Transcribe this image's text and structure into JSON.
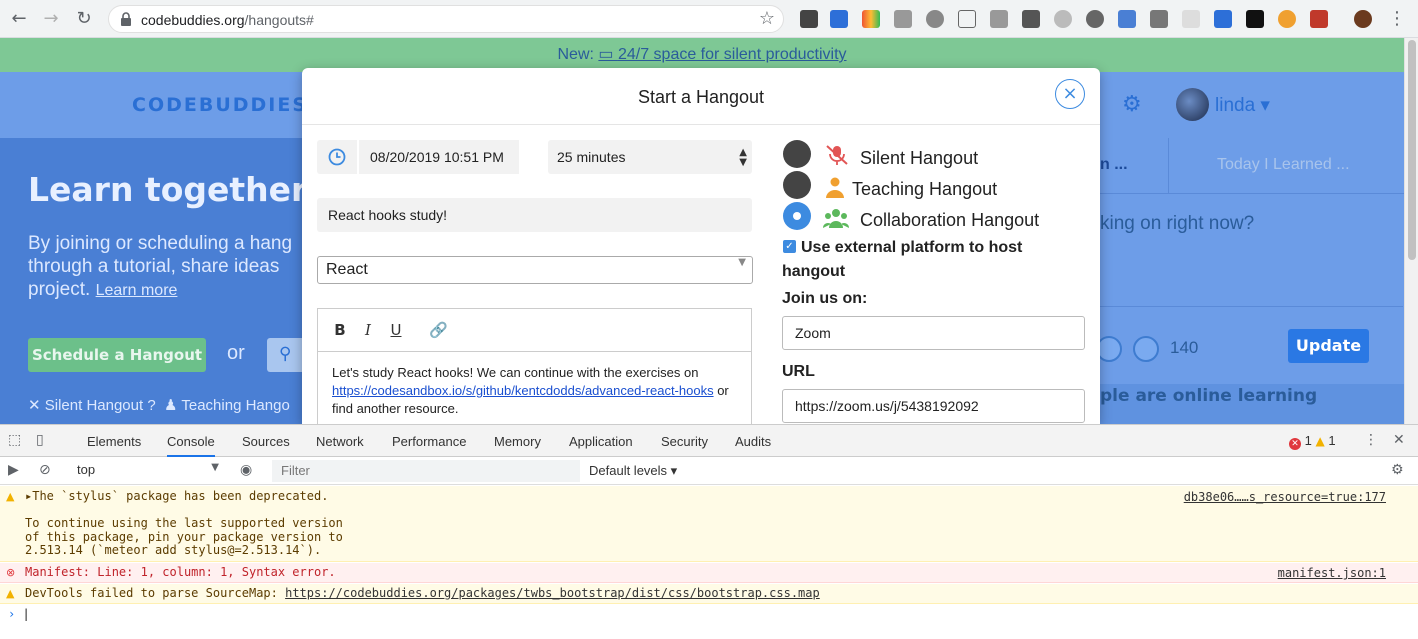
{
  "browser": {
    "url_domain": "codebuddies.org",
    "url_path": "/hangouts#"
  },
  "page": {
    "banner_prefix": "New: ",
    "banner_link": "24/7 space for silent productivity",
    "logo": "CODEBUDDIES",
    "username": "linda",
    "hero_title": "Learn together in",
    "hero_text_1": "By joining or scheduling a hang",
    "hero_text_2": "through a tutorial, share ideas",
    "hero_text_3": "project.",
    "learn_more": "Learn more",
    "schedule_button": "Schedule a Hangout",
    "or_text": "or",
    "legend_silent": "Silent Hangout",
    "legend_teaching": "Teaching Hango",
    "tab_working_on": "n ...",
    "tab_til": "Today I Learned ...",
    "textarea_placeholder": "king on right now?",
    "online_count": "140",
    "update_button": "Update",
    "online_text": "ple are online learning"
  },
  "modal": {
    "title": "Start a Hangout",
    "close_label": "×",
    "date_value": "08/20/2019 10:51 PM",
    "duration_value": "25 minutes",
    "topic_value": "React hooks study!",
    "tag_value": "React",
    "editor_text_1": "Let's study React hooks! We can continue with the exercises on",
    "editor_link": "https://codesandbox.io/s/github/kentcdodds/advanced-react-hooks",
    "editor_text_2": " or",
    "editor_text_3": "find another resource.",
    "hangout_types": [
      {
        "label": "Silent Hangout",
        "selected": false
      },
      {
        "label": "Teaching Hangout",
        "selected": false
      },
      {
        "label": "Collaboration Hangout",
        "selected": true
      }
    ],
    "external_label": "Use external platform to host hangout",
    "external_checked": true,
    "join_label": "Join us on:",
    "join_value": "Zoom",
    "url_label": "URL",
    "url_value": "https://zoom.us/j/5438192092"
  },
  "devtools": {
    "tabs": [
      "Elements",
      "Console",
      "Sources",
      "Network",
      "Performance",
      "Memory",
      "Application",
      "Security",
      "Audits"
    ],
    "active_tab": "Console",
    "error_count": "1",
    "warning_count": "1",
    "context": "top",
    "filter_placeholder": "Filter",
    "levels": "Default levels",
    "logs": [
      {
        "level": "warning",
        "text": "The `stylus` package has been deprecated.\n\nTo continue using the last supported version\nof this package, pin your package version to\n2.513.14 (`meteor add stylus@=2.513.14`).",
        "source": "db38e06……s_resource=true:177"
      },
      {
        "level": "error",
        "text": "Manifest: Line: 1, column: 1, Syntax error.",
        "source": "manifest.json:1"
      },
      {
        "level": "warning",
        "text_prefix": "DevTools failed to parse SourceMap: ",
        "link": "https://codebuddies.org/packages/twbs_bootstrap/dist/css/bootstrap.css.map"
      }
    ],
    "prompt": "›"
  },
  "colors": {
    "accent": "#3d8be0",
    "page_bg": "#4a7fd4",
    "banner_bg": "#7ec895"
  }
}
